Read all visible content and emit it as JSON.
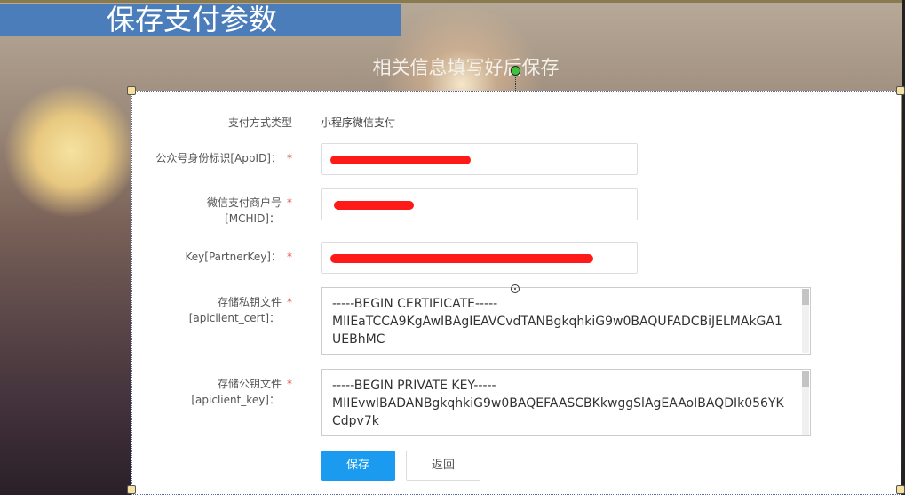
{
  "slide": {
    "title": "保存支付参数",
    "subtitle": "相关信息填写好后保存"
  },
  "form": {
    "payment_type": {
      "label": "支付方式类型",
      "value": "小程序微信支付"
    },
    "appid": {
      "label": "公众号身份标识[AppID]：",
      "required": "*"
    },
    "mchid": {
      "label_line1": "微信支付商户号",
      "label_line2": "[MCHID]：",
      "required": "*"
    },
    "partner_key": {
      "label": "Key[PartnerKey]：",
      "required": "*"
    },
    "cert": {
      "label_line1": "存储私钥文件",
      "label_line2": "[apiclient_cert]：",
      "required": "*",
      "line1": "-----BEGIN CERTIFICATE-----",
      "line2": "MIIEaTCCA9KgAwIBAgIEAVCvdTANBgkqhkiG9w0BAQUFADCBiJELMAkGA1",
      "line3": "UEBhMC"
    },
    "key": {
      "label_line1": "存储公钥文件",
      "label_line2": "[apiclient_key]：",
      "required": "*",
      "line1": "-----BEGIN PRIVATE KEY-----",
      "line2": "MIIEvwIBADANBgkqhkiG9w0BAQEFAASCBKkwggSlAgEAAoIBAQDIk056YK",
      "line3": "Cdpv7k"
    }
  },
  "buttons": {
    "save": "保存",
    "back": "返回"
  },
  "colors": {
    "title_bar": "#4a7dba",
    "primary_button": "#1a9bf0",
    "required": "#e05050",
    "redaction": "#ff1a1a"
  }
}
